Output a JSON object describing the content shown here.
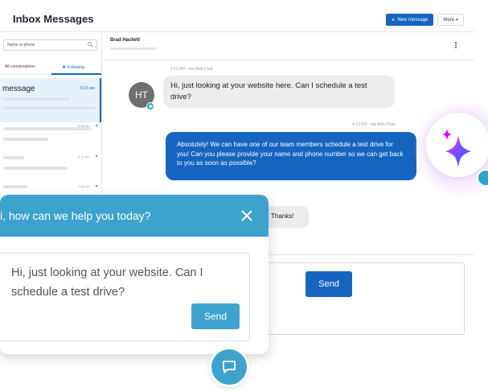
{
  "header": {
    "title": "Inbox Messages",
    "new_message_label": "New message",
    "more_label": "More"
  },
  "list": {
    "search_placeholder": "Name or phone",
    "tabs": [
      "All conversations",
      "Following"
    ],
    "active_conversation": {
      "preview": "message",
      "time": "9:15 am"
    },
    "items": [
      {
        "time": "9:55 am"
      },
      {
        "time": "8:19 am"
      },
      {
        "time": "7:56 am"
      }
    ]
  },
  "chat": {
    "contact_name": "Brad Hackett",
    "messages": [
      {
        "meta": "4:11 PM - via Web Chat",
        "avatar_initials": "HT",
        "text": "Hi, just looking at your website here. Can I schedule a test drive?"
      },
      {
        "meta": "4:12 PM - via Web Chat",
        "text": "Absolutely! We can have one of our team members schedule a test drive for you! Can you please provide your name and phone number so we can get back to you as soon as possible?"
      },
      {
        "text": "Thanks!"
      }
    ],
    "send_label": "Send"
  },
  "widget": {
    "greeting": "i, how can we help you today?",
    "message": "Hi, just looking at your website. Can I schedule a test drive?",
    "send_label": "Send"
  },
  "colors": {
    "primary": "#1565c0",
    "widget": "#3ea3cc"
  }
}
